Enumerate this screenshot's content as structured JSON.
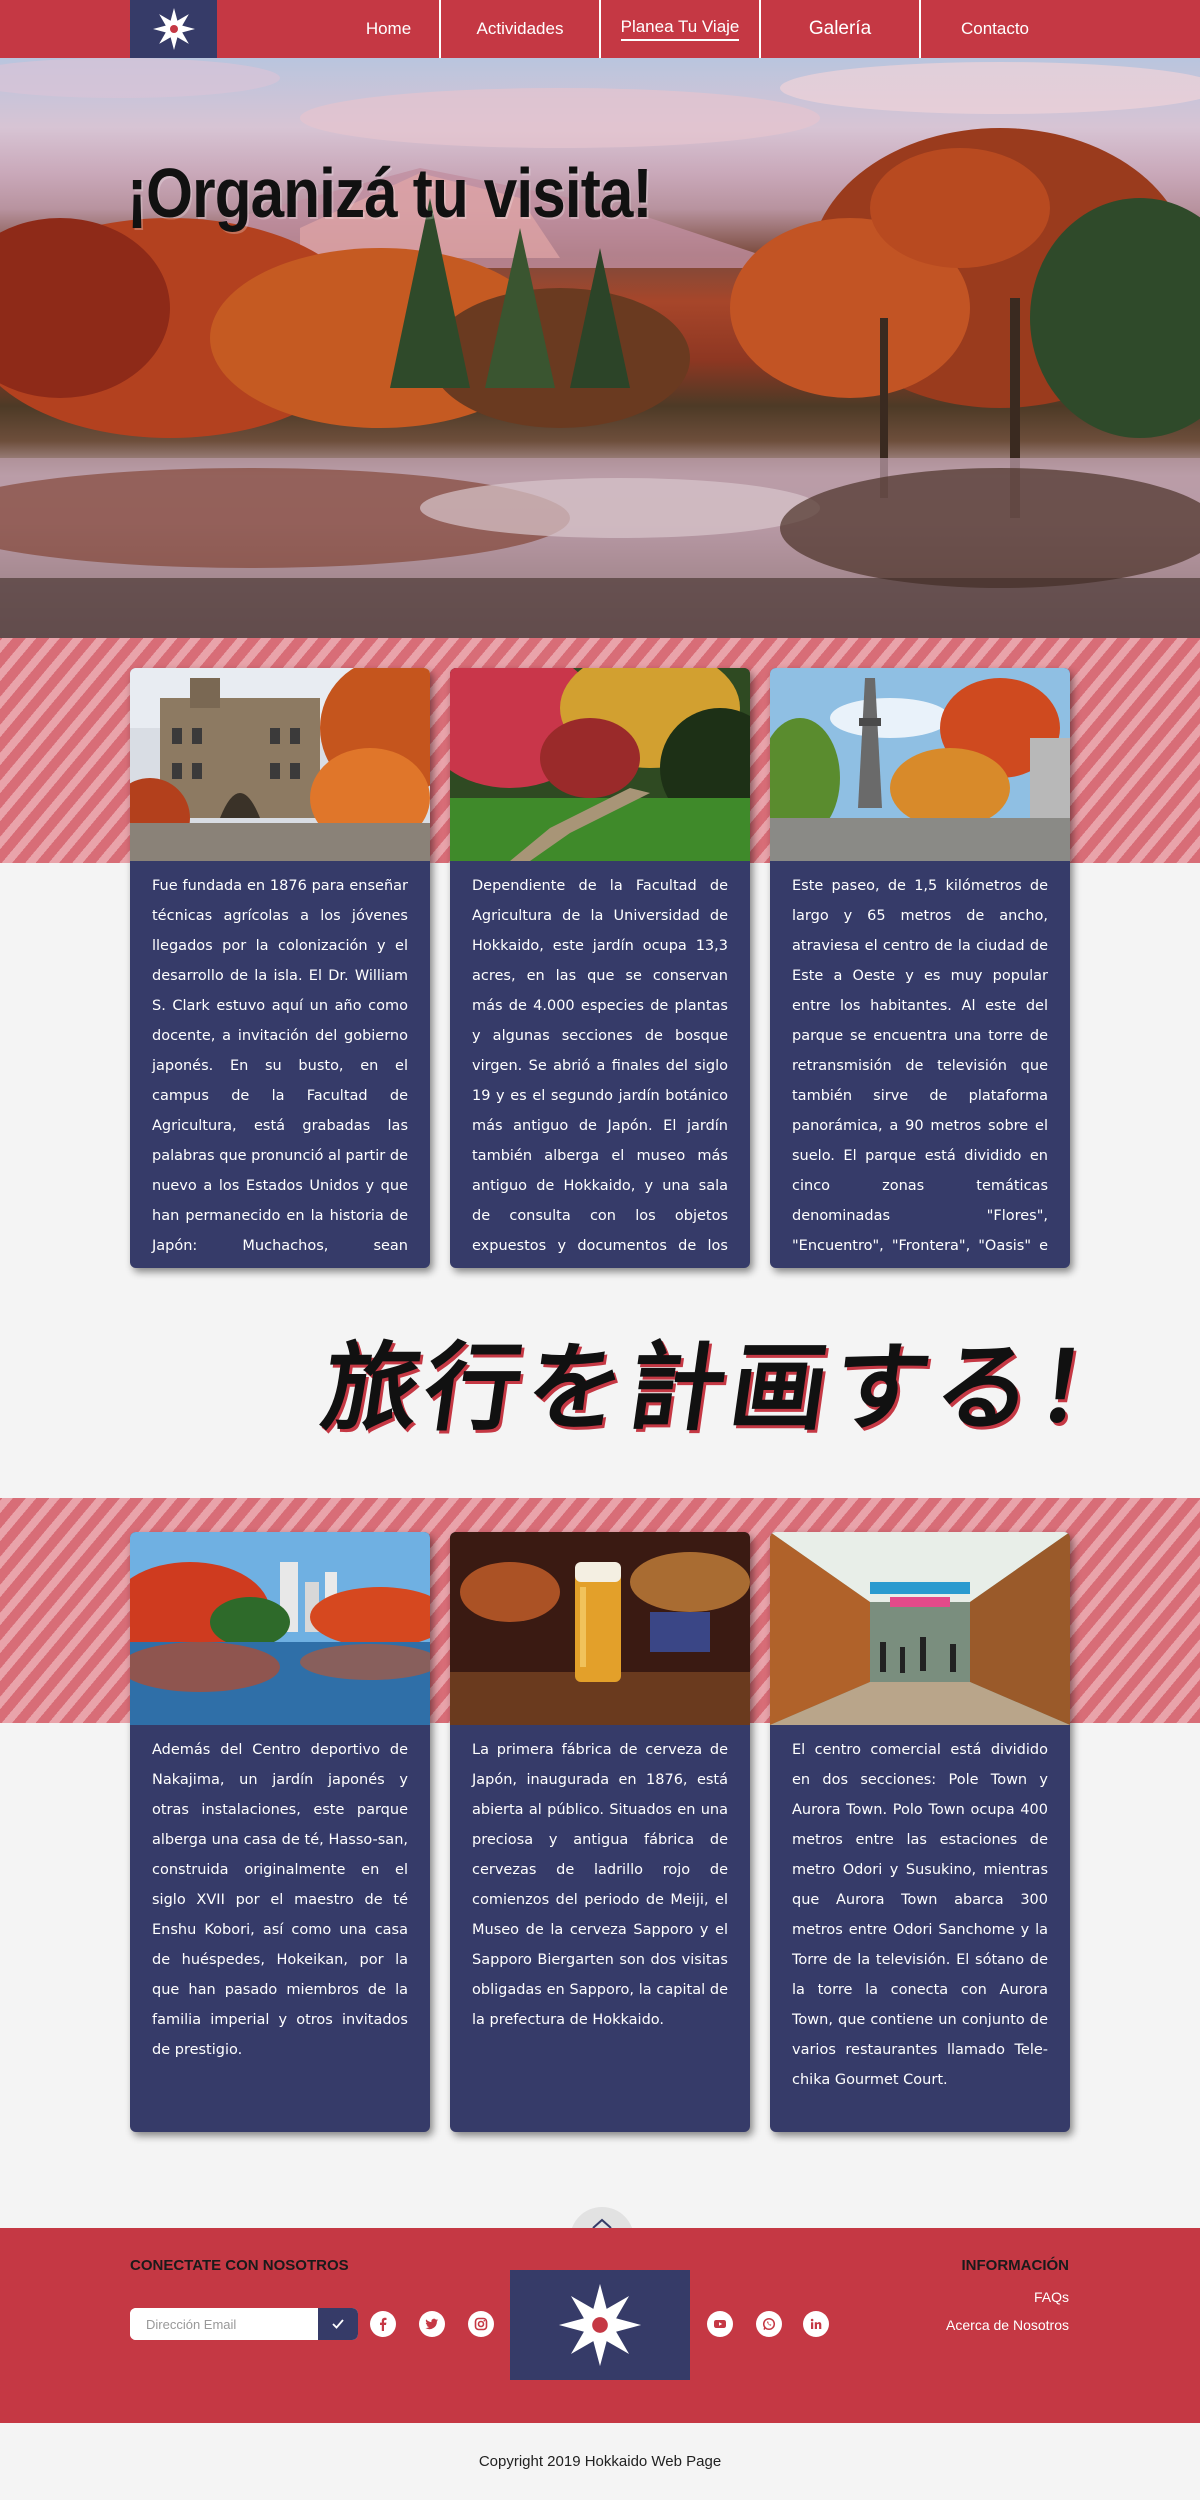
{
  "nav": {
    "items": [
      {
        "label": "Home"
      },
      {
        "label": "Actividades"
      },
      {
        "label": "Planea Tu Viaje"
      },
      {
        "label": "Galería"
      },
      {
        "label": "Contacto"
      }
    ],
    "active": "Planea Tu Viaje"
  },
  "hero": {
    "title": "¡Organizá tu visita!"
  },
  "cards_top": [
    {
      "text": "Fue fundada en 1876 para enseñar técnicas agrícolas a los jóvenes llegados por la colonización y el desarrollo de la isla. El Dr. William S. Clark estuvo aquí un año como docente, a invitación del gobierno japonés. En su busto, en el campus de la Facultad de Agricultura, está grabadas las palabras que pronunció al partir de nuevo a los Estados Unidos y que han permanecido en la historia de Japón: Muchachos, sean ambiciosos!"
    },
    {
      "text": "Dependiente de la Facultad de Agricultura de la Universidad de Hokkaido, este jardín ocupa 13,3 acres, en las que se conservan más de 4.000 especies de plantas y algunas secciones de bosque virgen. Se abrió a finales del siglo 19 y es el segundo jardín botánico más antiguo de Japón. El jardín también alberga el museo más antiguo de Hokkaido, y una sala de consulta con los objetos expuestos y documentos de los Ainu y los Uilta."
    },
    {
      "text": "Este paseo, de 1,5 kilómetros de largo y 65 metros de ancho, atraviesa el centro de la ciudad de Este a Oeste y es muy popular entre los habitantes. Al este del parque se encuentra una torre de retransmisión de televisión que también sirve de plataforma panorámica, a 90 metros sobre el suelo. El parque está dividido en cinco zonas temáticas denominadas \"Flores\", \"Encuentro\", \"Frontera\", \"Oasis\" e \"Intercambio\"."
    }
  ],
  "kanji_heading": "旅行を計画する！",
  "cards_bottom": [
    {
      "text": "Además del Centro deportivo de Nakajima, un jardín japonés y otras instalaciones, este parque alberga una casa de té, Hasso-san, construida originalmente en el siglo XVII por el maestro de té Enshu Kobori, así como una casa de huéspedes, Hokeikan, por la que han pasado miembros de la familia imperial y otros invitados de prestigio."
    },
    {
      "text": "La primera fábrica de cerveza de Japón, inaugurada en 1876, está abierta al público. Situados en una preciosa y antigua fábrica de cervezas de ladrillo rojo de comienzos del periodo de Meiji, el Museo de la cerveza Sapporo y el Sapporo Biergarten son dos visitas obligadas en Sapporo, la capital de la prefectura de Hokkaido."
    },
    {
      "text": "El centro comercial está dividido en dos secciones: Pole Town y Aurora Town. Polo Town ocupa 400 metros entre las estaciones de metro Odori y Susukino, mientras que Aurora Town abarca 300 metros entre Odori Sanchome y la Torre de la televisión. El sótano de la torre la conecta con Aurora Town, que contiene un conjunto de varios restaurantes llamado Tele-chika Gourmet Court."
    }
  ],
  "footer": {
    "connect_title": "CONECTATE CON NOSOTROS",
    "email_placeholder": "Dirección Email",
    "info_title": "INFORMACIÓN",
    "links": [
      "FAQs",
      "Acerca de Nosotros"
    ],
    "social_icons": [
      "facebook-icon",
      "twitter-icon",
      "instagram-icon",
      "youtube-icon",
      "whatsapp-icon",
      "linkedin-icon"
    ]
  },
  "copyright": "Copyright 2019 Hokkaido Web Page",
  "colors": {
    "primary_red": "#c53844",
    "navy": "#363b68",
    "stripe_dark": "#d86d77",
    "stripe_light": "#e9a3aa",
    "background": "#f4f4f4"
  }
}
